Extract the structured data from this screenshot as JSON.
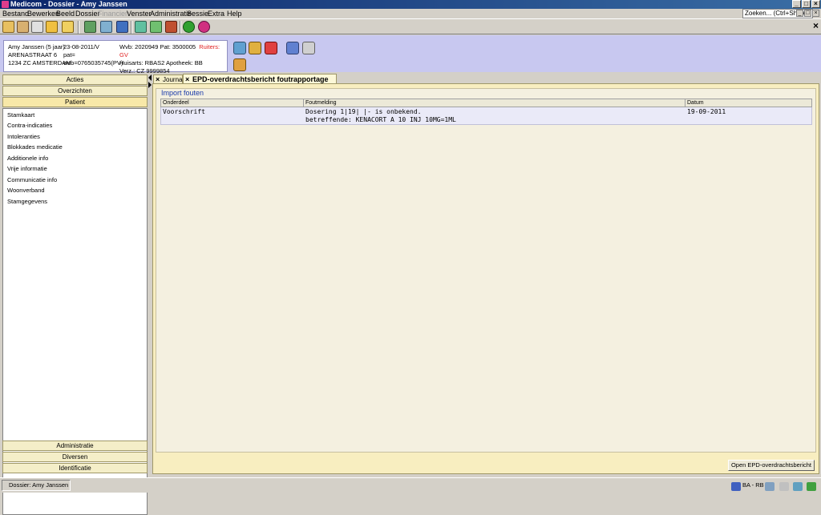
{
  "window": {
    "title": "Medicom - Dossier - Amy Janssen"
  },
  "menu": {
    "items": [
      "Bestand",
      "Bewerken",
      "Beeld",
      "Dossier",
      "Financien",
      "Venster",
      "Administratie",
      "Sessie",
      "Extra",
      "Help"
    ],
    "disabled": [
      "Financien"
    ],
    "search_placeholder": "Zoeken... (Ctrl+Shift+F)"
  },
  "patient": {
    "name": "Amy Janssen (5 jaar)",
    "address": "ARENASTRAAT 6",
    "city": "1234 ZC AMSTERDAM",
    "date": "23-08-2011/V",
    "pat": "pat=",
    "wvb_full": "wvb=0765035745(PV)",
    "wvb_pat": "Wvb: 2020949 Pat: 3500005",
    "ruiters": "Ruiters: GV",
    "huisarts": "Huisarts: RBAS2 Apotheek: BB",
    "verz": "Verz.: CZ 9999854"
  },
  "nav": {
    "top_buttons": [
      "Acties",
      "Overzichten",
      "Patient"
    ],
    "patient_links": [
      "Stamkaart",
      "Contra-indicaties",
      "Intoleranties",
      "Blokkades medicatie",
      "Additionele info",
      "Vrije informatie",
      "Communicatie info",
      "Woonverband",
      "Stamgegevens"
    ],
    "bottom_buttons": [
      "Administratie",
      "Diversen",
      "Identificatie"
    ]
  },
  "tabs": [
    {
      "label": "Journaal"
    },
    {
      "label": "EPD-overdrachtsbericht foutrapportage"
    }
  ],
  "import_errors": {
    "group_title": "Import fouten",
    "columns": [
      "Onderdeel",
      "Foutmelding",
      "Datum"
    ],
    "rows": [
      {
        "onderdeel": "Voorschrift",
        "foutmelding_1": "Dosering 1|19| |- is onbekend.",
        "foutmelding_2": "betreffende: KENACORT A 10 INJ 10MG=1ML",
        "datum": "19-09-2011"
      }
    ],
    "open_button": "Open EPD-overdrachtsbericht"
  },
  "statusbar": {
    "task": "Dossier: Amy Janssen",
    "user": "BA - RB"
  }
}
